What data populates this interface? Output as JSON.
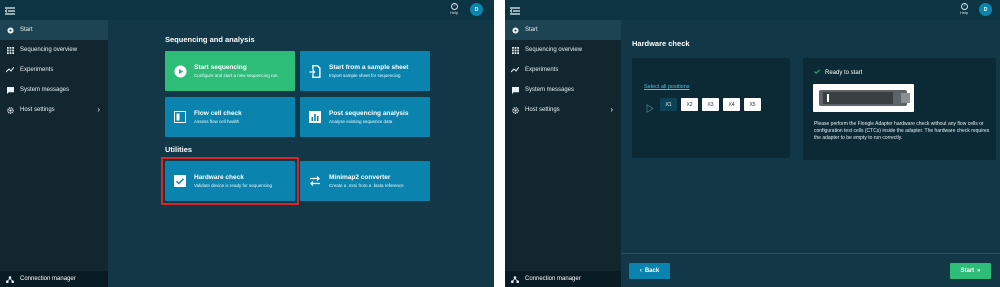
{
  "colors": {
    "frame_bg": "#0f3b4b",
    "sidebar_bg": "#11262f",
    "card_blue": "#0a84ae",
    "card_green": "#2ebd79",
    "highlight": "#d62828",
    "avatar": "#0a85ae"
  },
  "header": {
    "help_label": "Help",
    "avatar_initial": "D"
  },
  "sidebar": {
    "items": [
      {
        "label": "Start",
        "icon": "disc-icon"
      },
      {
        "label": "Sequencing overview",
        "icon": "grid-icon"
      },
      {
        "label": "Experiments",
        "icon": "trend-icon"
      },
      {
        "label": "System messages",
        "icon": "chat-icon"
      },
      {
        "label": "Host settings",
        "icon": "gear-icon"
      }
    ],
    "connection_manager": "Connection manager"
  },
  "start_page": {
    "section_sequencing": "Sequencing and analysis",
    "section_utilities": "Utilities",
    "cards": [
      {
        "title": "Start sequencing",
        "subtitle": "Configure and start a new sequencing run",
        "icon": "play-icon"
      },
      {
        "title": "Start from a sample sheet",
        "subtitle": "Import sample sheet for sequencing",
        "icon": "import-icon"
      },
      {
        "title": "Flow cell check",
        "subtitle": "Assess flow cell health",
        "icon": "flowcell-icon"
      },
      {
        "title": "Post sequencing analysis",
        "subtitle": "Analyse existing sequence data",
        "icon": "bar-chart-icon"
      },
      {
        "title": "Hardware check",
        "subtitle": "Validate device is ready for sequencing",
        "icon": "check-box-icon"
      },
      {
        "title": "Minimap2 converter",
        "subtitle": "Create a .mmi from a .fasta reference",
        "icon": "swap-icon"
      }
    ]
  },
  "hardware_page": {
    "title": "Hardware check",
    "select_all": "Select all positions",
    "positions": [
      "X1",
      "X2",
      "X3",
      "X4",
      "X5"
    ],
    "selected_position": "X1",
    "ready_label": "Ready to start",
    "description": "Please perform the Flongle Adapter hardware check without any flow cells or configuration test cells (CTCs) inside the adapter. The hardware check requires the adapter to be empty to run correctly.",
    "back_button": "Back",
    "start_button": "Start"
  }
}
